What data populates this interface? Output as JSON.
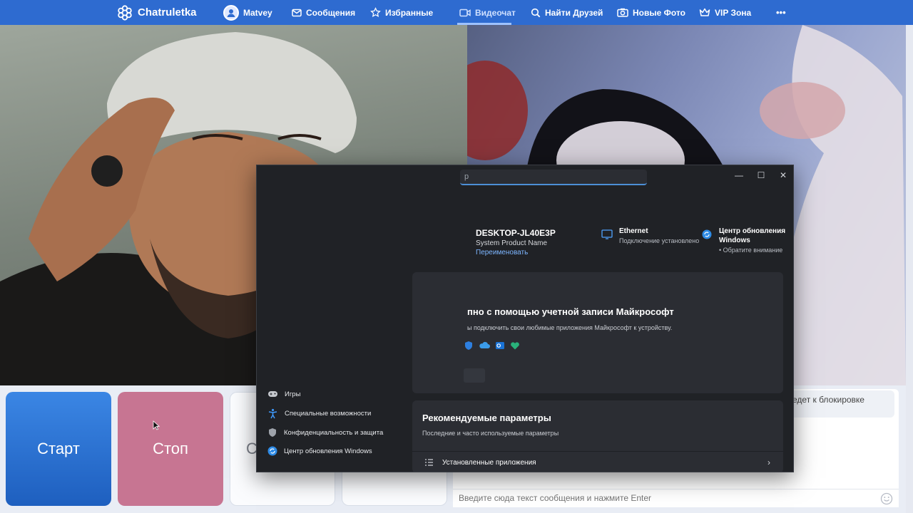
{
  "nav": {
    "brand": "Chatruletka",
    "user": "Matvey",
    "messages": "Сообщения",
    "favorites": "Избранные",
    "videochat": "Видеочат",
    "find_friends": "Найти Друзей",
    "new_photos": "Новые Фото",
    "vip": "VIP Зона",
    "more": "•••"
  },
  "controls": {
    "start_label": "Старт",
    "stop_label": "Стоп",
    "third_label": "С"
  },
  "chat": {
    "notice": "едет к блокировке",
    "input_placeholder": "Введите сюда текст сообщения и нажмите Enter"
  },
  "settings": {
    "search_text": "р",
    "minimize": "—",
    "maximize": "☐",
    "close": "✕",
    "device_name": "DESKTOP-JL40E3P",
    "product_name": "System Product Name",
    "rename": "Переименовать",
    "ethernet_title": "Ethernet",
    "ethernet_status": "Подключение установлено",
    "update_title_line1": "Центр обновления",
    "update_title_line2": "Windows",
    "update_status": "• Обратите внимание",
    "ms_title": "пно с помощью учетной записи Майкрософт",
    "ms_desc": "ы подключить свои любимые приложения Майкрософт к устройству.",
    "rec_title": "Рекомендуемые параметры",
    "rec_sub": "Последние и часто используемые параметры",
    "rec_item": "Установленные приложения",
    "rec_chevron": "›",
    "sidebar": [
      {
        "label": "Игры"
      },
      {
        "label": "Специальные возможности"
      },
      {
        "label": "Конфиденциальность и защита"
      },
      {
        "label": "Центр обновления Windows"
      }
    ]
  },
  "colors": {
    "nav_bg": "#2e6bd0",
    "start": "#2b74d6",
    "stop": "#c77592",
    "settings_bg": "#202226",
    "accent_link": "#7db6ff"
  }
}
